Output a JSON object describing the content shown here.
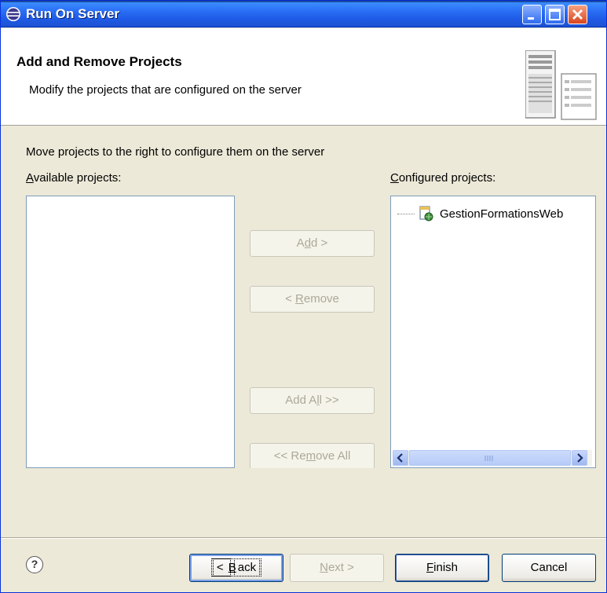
{
  "window": {
    "title": "Run On Server"
  },
  "header": {
    "title": "Add and Remove Projects",
    "description": "Modify the projects that are configured on the server"
  },
  "content": {
    "instruction": "Move projects to the right to configure them on the server",
    "available_label": {
      "prefix": "",
      "accel": "A",
      "rest": "vailable projects:"
    },
    "configured_label": {
      "prefix": "",
      "accel": "C",
      "rest": "onfigured projects:"
    },
    "available_projects": [],
    "configured_projects": [
      {
        "name": "GestionFormationsWeb",
        "icon": "web-project-icon"
      }
    ]
  },
  "buttons": {
    "add": {
      "prefix": "A",
      "accel": "d",
      "rest": "d >",
      "enabled": false
    },
    "remove": {
      "prefix": "< ",
      "accel": "R",
      "rest": "emove",
      "enabled": false
    },
    "add_all": {
      "prefix": "Add A",
      "accel": "l",
      "rest": "l >>",
      "enabled": false
    },
    "remove_all": {
      "prefix": "<< Re",
      "accel": "m",
      "rest": "ove All",
      "enabled": false
    }
  },
  "footer": {
    "back": {
      "prefix": "< ",
      "accel": "B",
      "rest": "ack",
      "enabled": true
    },
    "next": {
      "prefix": "",
      "accel": "N",
      "rest": "ext >",
      "enabled": false
    },
    "finish": {
      "prefix": "",
      "accel": "F",
      "rest": "inish",
      "enabled": true
    },
    "cancel": {
      "label": "Cancel",
      "enabled": true
    }
  },
  "colors": {
    "titlebar": "#2A6EF5",
    "dialog_bg": "#ECE9D8",
    "disabled_text": "#ACA899"
  }
}
